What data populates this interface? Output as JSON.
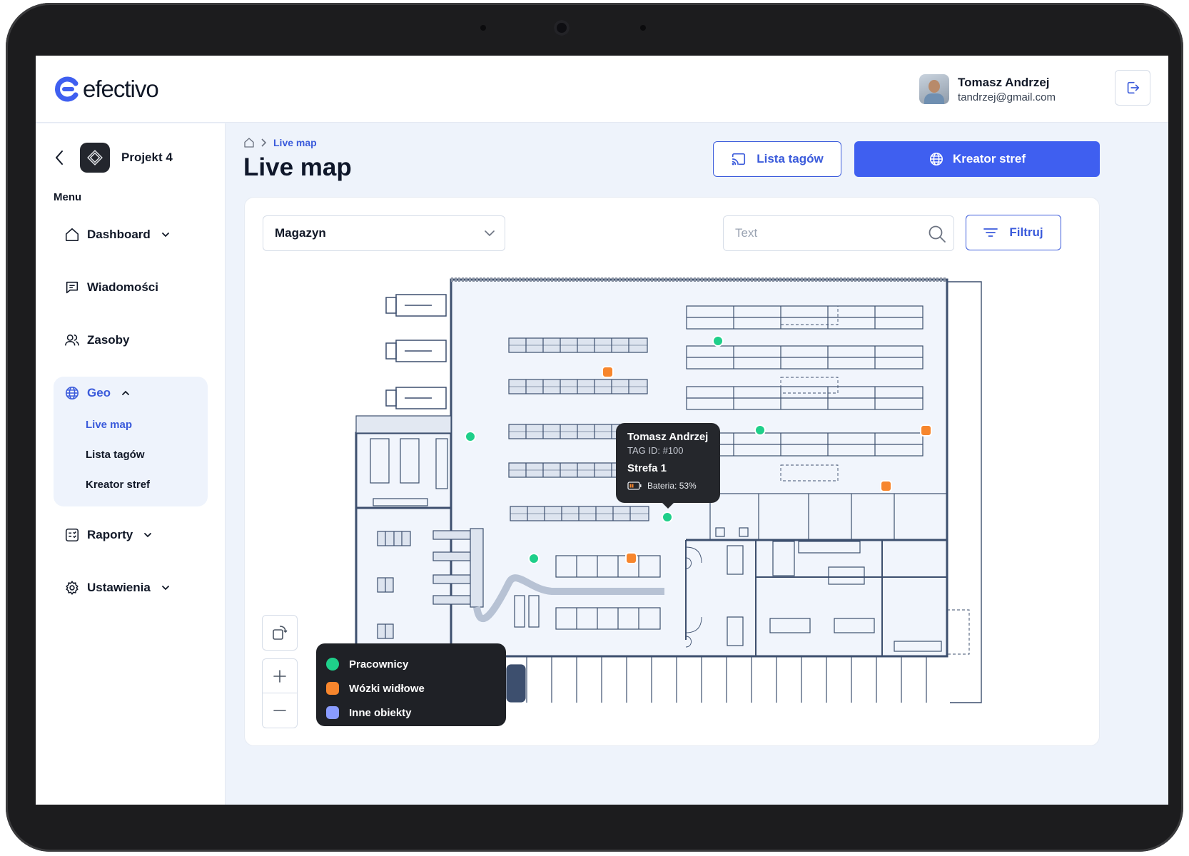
{
  "app": {
    "logo_text": "efectivo",
    "accent_color": "#3f5ff0"
  },
  "user": {
    "name": "Tomasz Andrzej",
    "email": "tandrzej@gmail.com"
  },
  "project": {
    "name": "Projekt 4"
  },
  "sidebar": {
    "menu_label": "Menu",
    "items": [
      {
        "label": "Dashboard",
        "icon": "home-icon"
      },
      {
        "label": "Wiadomości",
        "icon": "chat-icon"
      },
      {
        "label": "Zasoby",
        "icon": "users-icon"
      },
      {
        "label": "Geo",
        "icon": "globe-icon"
      },
      {
        "label": "Raporty",
        "icon": "report-icon"
      },
      {
        "label": "Ustawienia",
        "icon": "gear-icon"
      }
    ],
    "geo_sub": [
      {
        "label": "Live map",
        "active": true
      },
      {
        "label": "Lista tagów",
        "active": false
      },
      {
        "label": "Kreator stref",
        "active": false
      }
    ]
  },
  "breadcrumb": {
    "current": "Live map"
  },
  "page": {
    "title": "Live map",
    "tags_button": "Lista tagów",
    "zones_button": "Kreator stref"
  },
  "toolbar": {
    "location": "Magazyn",
    "search_placeholder": "Text",
    "filter_label": "Filtruj"
  },
  "tooltip": {
    "name": "Tomasz Andrzej",
    "tag_id": "TAG ID: #100",
    "zone": "Strefa 1",
    "battery": "Bateria: 53%"
  },
  "legend": [
    {
      "label": "Pracownicy",
      "color": "#1fcf8a"
    },
    {
      "label": "Wózki widłowe",
      "color": "#f7862d"
    },
    {
      "label": "Inne obiekty",
      "color": "#8a9cff"
    }
  ]
}
